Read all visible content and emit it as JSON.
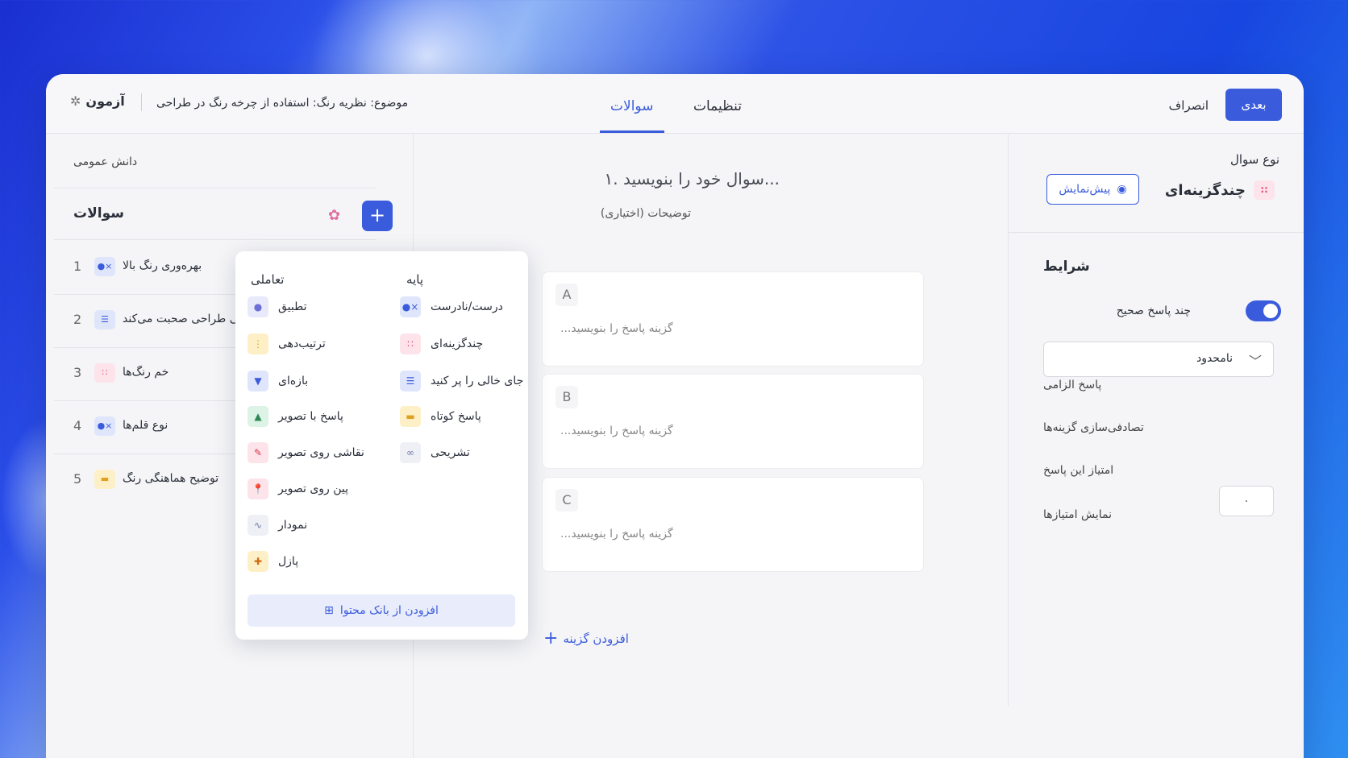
{
  "header": {
    "brand": "آزمون",
    "topic": "موضوع: نظریه رنگ: استفاده از چرخه رنگ در طراحی",
    "tabs": [
      "سوالات",
      "تنظیمات"
    ],
    "active_tab": "سوالات",
    "next_label": "بعدی",
    "cancel_label": "انصراف"
  },
  "sidebar": {
    "category": "دانش عمومی",
    "title": "سوالات",
    "questions": [
      {
        "num": "1",
        "label": "بهره‌وری رنگ بالا",
        "icon": "true-false-icon"
      },
      {
        "num": "2",
        "label": "وقتی طراحی صحبت می‌کند",
        "icon": "fill-blank-icon"
      },
      {
        "num": "3",
        "label": "خم رنگ‌ها",
        "icon": "multiple-choice-icon"
      },
      {
        "num": "4",
        "label": "نوع قلم‌ها",
        "icon": "true-false-icon"
      },
      {
        "num": "5",
        "label": "توضیح هماهنگی رنگ",
        "icon": "short-answer-icon"
      }
    ]
  },
  "dropdown": {
    "col_basic": "پایه",
    "col_interactive": "تعاملی",
    "basic": [
      {
        "label": "درست/نادرست",
        "icon": "true-false-icon"
      },
      {
        "label": "چندگزینه‌ای",
        "icon": "multiple-choice-icon"
      },
      {
        "label": "جای خالی را پر کنید",
        "icon": "fill-blank-icon"
      },
      {
        "label": "پاسخ کوتاه",
        "icon": "short-answer-icon"
      },
      {
        "label": "تشریحی",
        "icon": "essay-icon"
      }
    ],
    "interactive": [
      {
        "label": "تطبیق",
        "icon": "matching-icon"
      },
      {
        "label": "ترتیب‌دهی",
        "icon": "ordering-icon"
      },
      {
        "label": "بازه‌ای",
        "icon": "range-icon"
      },
      {
        "label": "پاسخ با تصویر",
        "icon": "image-answer-icon"
      },
      {
        "label": "نقاشی روی تصویر",
        "icon": "draw-icon"
      },
      {
        "label": "پین روی تصویر",
        "icon": "pin-icon"
      },
      {
        "label": "نمودار",
        "icon": "graph-icon"
      },
      {
        "label": "پازل",
        "icon": "puzzle-icon"
      }
    ],
    "bank_label": "افزودن از بانک محتوا"
  },
  "editor": {
    "question_placeholder": "۱. سوال خود را بنویسید...",
    "description_placeholder": "توضیحات (اختیاری)",
    "options": [
      {
        "letter": "A",
        "placeholder": "گزینه پاسخ را بنویسید..."
      },
      {
        "letter": "B",
        "placeholder": "گزینه پاسخ را بنویسید..."
      },
      {
        "letter": "C",
        "placeholder": "گزینه پاسخ را بنویسید..."
      }
    ],
    "add_option": "افزودن گزینه"
  },
  "settings": {
    "type_label": "نوع سوال",
    "type_value": "چندگزینه‌ای",
    "preview_label": "پیش‌نمایش",
    "conditions_title": "شرایط",
    "multi_correct_label": "چند پاسخ صحیح",
    "multi_correct_on": true,
    "limit_value": "نامحدود",
    "required_label": "پاسخ الزامی",
    "shuffle_label": "تصادفی‌سازی گزینه‌ها",
    "score_label": "امتیاز این پاسخ",
    "score_value": "۰",
    "show_scores_label": "نمایش امتیازها"
  },
  "colors": {
    "accent": "#3a5bdc",
    "pink": "#e0457a"
  }
}
